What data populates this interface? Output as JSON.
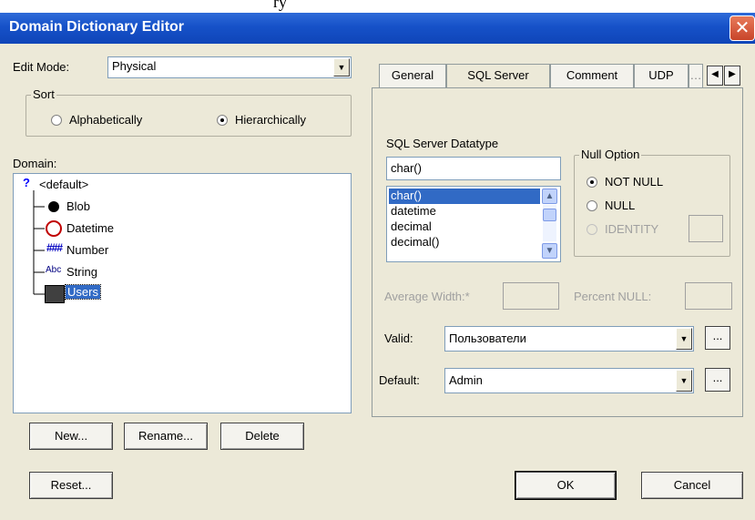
{
  "window": {
    "title": "Domain Dictionary Editor"
  },
  "top_strip_text": "ry",
  "edit_mode": {
    "label": "Edit Mode:",
    "value": "Physical"
  },
  "sort": {
    "title": "Sort",
    "options": [
      {
        "label": "Alphabetically",
        "selected": false
      },
      {
        "label": "Hierarchically",
        "selected": true
      }
    ]
  },
  "domain": {
    "label": "Domain:",
    "root": "<default>",
    "items": [
      "Blob",
      "Datetime",
      "Number",
      "String",
      "Users"
    ],
    "selected": "Users"
  },
  "left_buttons": {
    "new": "New...",
    "rename": "Rename...",
    "delete": "Delete",
    "reset": "Reset..."
  },
  "tabs": [
    "General",
    "SQL Server",
    "Comment",
    "UDP"
  ],
  "active_tab": "SQL Server",
  "datatype": {
    "label": "SQL Server Datatype",
    "value": "char()",
    "list": [
      "char()",
      "datetime",
      "decimal",
      "decimal()"
    ],
    "selected": "char()"
  },
  "null_option": {
    "title": "Null Option",
    "options": [
      {
        "label": "NOT NULL",
        "selected": true,
        "enabled": true
      },
      {
        "label": "NULL",
        "selected": false,
        "enabled": true
      },
      {
        "label": "IDENTITY",
        "selected": false,
        "enabled": false
      }
    ]
  },
  "average_width": {
    "label": "Average Width:*",
    "value": ""
  },
  "percent_null": {
    "label": "Percent NULL:",
    "value": ""
  },
  "valid": {
    "label": "Valid:",
    "value": "Пользователи",
    "more": "..."
  },
  "default": {
    "label": "Default:",
    "value": "Admin",
    "more": "..."
  },
  "dialog_buttons": {
    "ok": "OK",
    "cancel": "Cancel"
  },
  "colors": {
    "title_bar": "#1651c8",
    "selection": "#316ac5",
    "face": "#ece9d8"
  }
}
